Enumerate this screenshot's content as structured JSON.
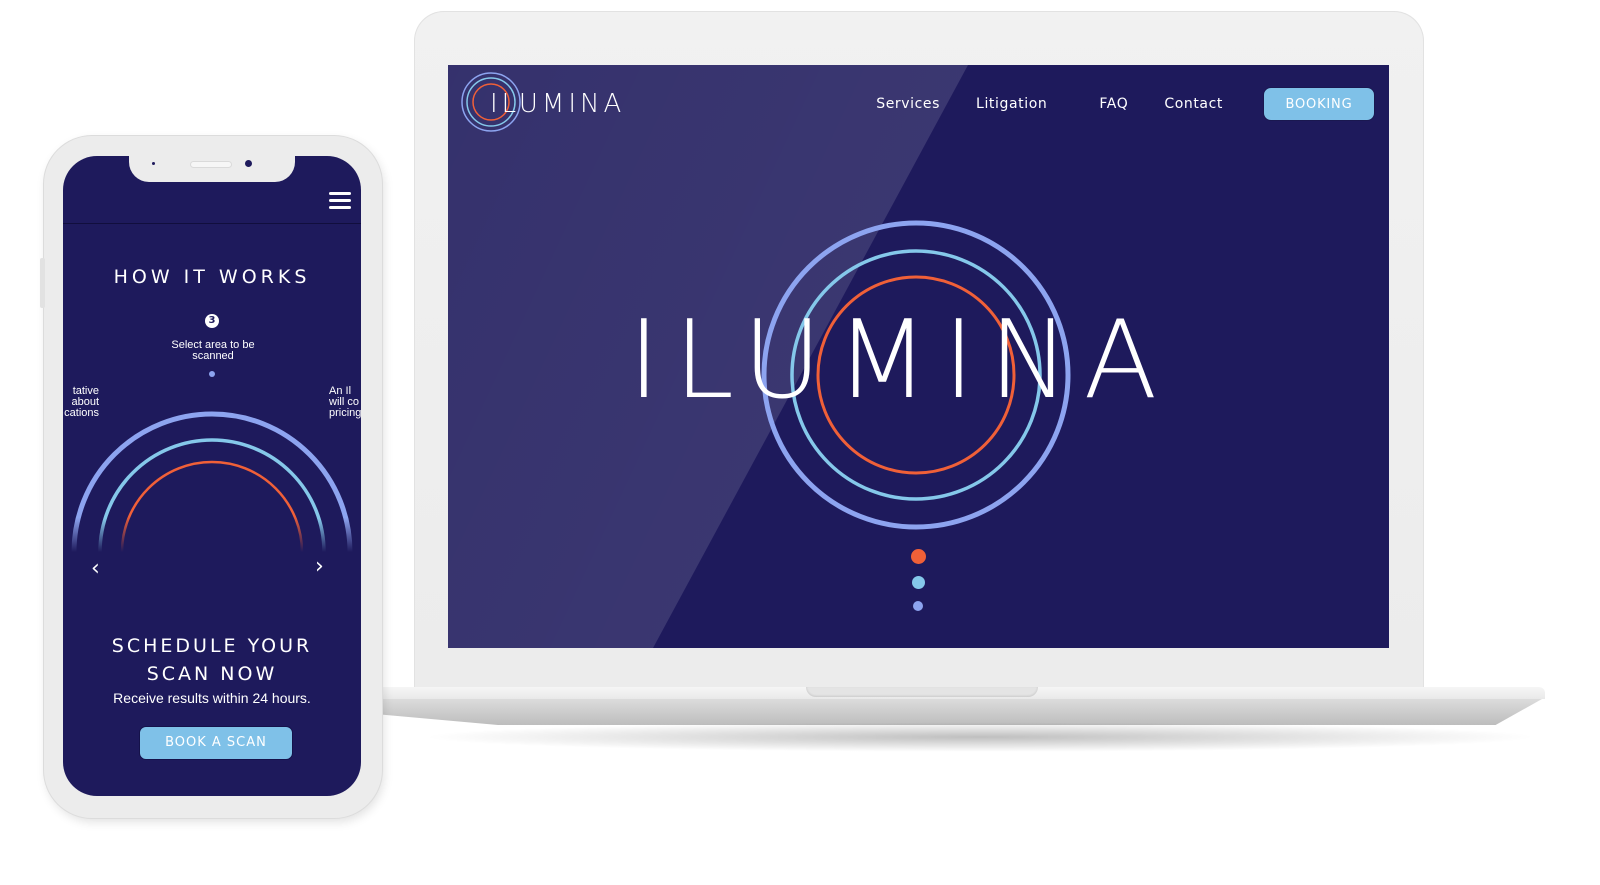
{
  "colors": {
    "navy": "#1e1a5c",
    "accent_blue": "#7fc1e8",
    "ring_outer": "#8da4f0",
    "ring_middle": "#85c8ea",
    "ring_inner": "#f06038"
  },
  "laptop": {
    "logo": {
      "text": "ILUMINA"
    },
    "nav": {
      "items": [
        {
          "label": "Services"
        },
        {
          "label": "Litigation"
        },
        {
          "label": "FAQ"
        },
        {
          "label": "Contact"
        }
      ],
      "booking_label": "BOOKING"
    },
    "hero": {
      "wordmark": "ILUMINA",
      "slider_dots": [
        {
          "state": "active",
          "color": "#f06038"
        },
        {
          "state": "inactive",
          "color": "#85c8ea"
        },
        {
          "state": "inactive",
          "color": "#8da4f0"
        }
      ]
    }
  },
  "phone": {
    "menu_icon": "hamburger-icon",
    "how_it_works": {
      "title": "HOW IT WORKS",
      "current_step": {
        "number": "3",
        "text": "Select area to be scanned"
      },
      "prev_step_fragment": "...tative\n... about\n...cations",
      "prev_step_lines": [
        "tative",
        "about",
        "cations"
      ],
      "next_step_lines": [
        "An Il",
        "will co",
        "pricing"
      ],
      "prev_arrow": "‹",
      "next_arrow": "›"
    },
    "cta": {
      "title_line1": "SCHEDULE YOUR",
      "title_line2": "SCAN NOW",
      "subtitle": "Receive results within 24 hours.",
      "button_label": "BOOK A SCAN"
    }
  }
}
